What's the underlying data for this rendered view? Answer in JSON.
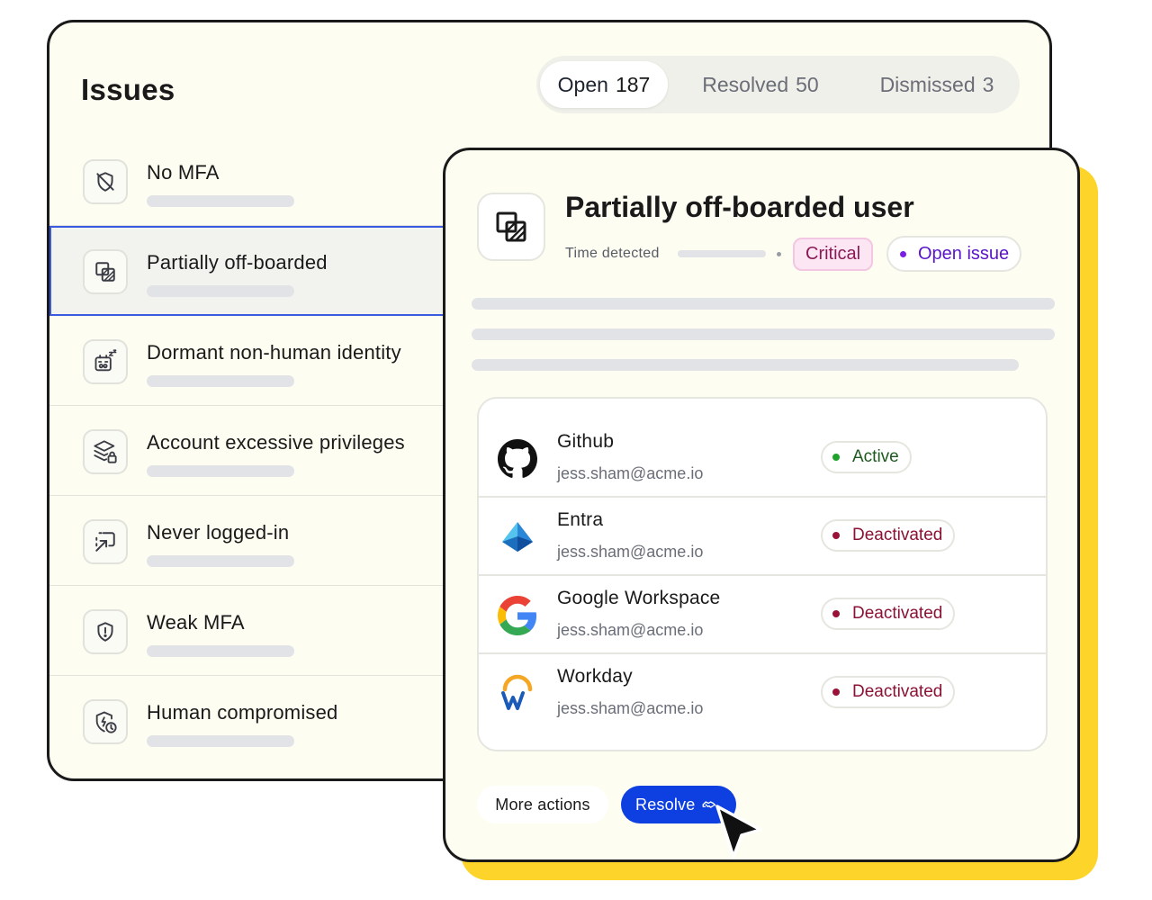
{
  "issues_panel": {
    "title": "Issues",
    "status_tabs": [
      {
        "label": "Open",
        "count": "187"
      },
      {
        "label": "Resolved",
        "count": "50"
      },
      {
        "label": "Dismissed",
        "count": "3"
      }
    ],
    "items": [
      {
        "label": "No MFA",
        "icon": "shield-off-icon"
      },
      {
        "label": "Partially off-boarded",
        "icon": "partial-offboard-icon"
      },
      {
        "label": "Dormant non-human identity",
        "icon": "sleeping-bot-icon"
      },
      {
        "label": "Account excessive privileges",
        "icon": "layers-lock-icon"
      },
      {
        "label": "Never logged-in",
        "icon": "login-arrow-icon"
      },
      {
        "label": "Weak MFA",
        "icon": "shield-alert-icon"
      },
      {
        "label": "Human compromised",
        "icon": "shield-clock-icon"
      }
    ]
  },
  "detail": {
    "title": "Partially off-boarded user",
    "time_detected_label": "Time detected",
    "severity": "Critical",
    "status": "Open issue",
    "accounts": [
      {
        "app": "Github",
        "email": "jess.sham@acme.io",
        "status": "Active",
        "icon": "github-icon"
      },
      {
        "app": "Entra",
        "email": "jess.sham@acme.io",
        "status": "Deactivated",
        "icon": "entra-icon"
      },
      {
        "app": "Google Workspace",
        "email": "jess.sham@acme.io",
        "status": "Deactivated",
        "icon": "google-icon"
      },
      {
        "app": "Workday",
        "email": "jess.sham@acme.io",
        "status": "Deactivated",
        "icon": "workday-icon"
      }
    ],
    "more_actions_label": "More actions",
    "resolve_label": "Resolve"
  },
  "colors": {
    "active": "#1fa32a",
    "deactivated": "#9a1238",
    "accent_blue": "#0e3fe0",
    "highlight_yellow": "#fdd42a",
    "open_issue_purple": "#7a1fe0"
  }
}
